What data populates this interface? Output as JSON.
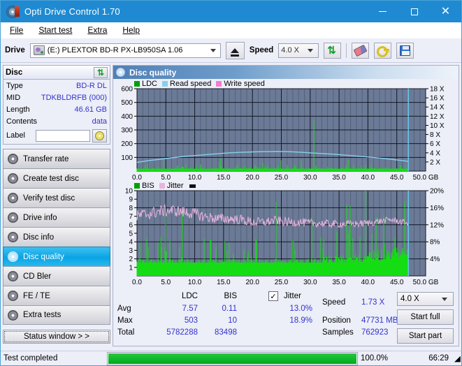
{
  "window": {
    "title": "Opti Drive Control 1.70",
    "icon": "disc-icon",
    "minimize": "minimize-icon",
    "maximize": "maximize-icon",
    "close": "close-icon"
  },
  "menu": [
    {
      "label": "File"
    },
    {
      "label": "Start test"
    },
    {
      "label": "Extra"
    },
    {
      "label": "Help"
    }
  ],
  "toolbar": {
    "drive_label": "Drive",
    "drive_value": "(E:)   PLEXTOR BD-R  PX-LB950SA 1.06",
    "eject_icon": "eject-icon",
    "speed_label": "Speed",
    "speed_value": "4.0 X",
    "refresh_icon": "refresh-icon",
    "eraser_icon": "eraser-icon",
    "key_icon": "key-icon",
    "save_icon": "save-icon"
  },
  "disc_panel": {
    "title": "Disc",
    "refresh_icon": "refresh-icon",
    "rows": [
      {
        "key": "Type",
        "value": "BD-R DL"
      },
      {
        "key": "MID",
        "value": "TDKBLDRFB (000)"
      },
      {
        "key": "Length",
        "value": "46.61 GB"
      },
      {
        "key": "Contents",
        "value": "data"
      }
    ],
    "label_key": "Label",
    "label_value": "",
    "label_button_icon": "disc-icon"
  },
  "nav": {
    "items": [
      {
        "label": "Transfer rate",
        "active": false
      },
      {
        "label": "Create test disc",
        "active": false
      },
      {
        "label": "Verify test disc",
        "active": false
      },
      {
        "label": "Drive info",
        "active": false
      },
      {
        "label": "Disc info",
        "active": false
      },
      {
        "label": "Disc quality",
        "active": true
      },
      {
        "label": "CD Bler",
        "active": false
      },
      {
        "label": "FE / TE",
        "active": false
      },
      {
        "label": "Extra tests",
        "active": false
      }
    ],
    "status_window": "Status window > >"
  },
  "main": {
    "title": "Disc quality",
    "icon": "disc-quality-icon"
  },
  "chart_data": [
    {
      "type": "line",
      "name": "ldc-chart",
      "title": "",
      "xlabel": "GB",
      "ylabel": "",
      "xlim": [
        0,
        50
      ],
      "ylim": [
        0,
        600
      ],
      "ylim_right": [
        0,
        18
      ],
      "grid": true,
      "legend_position": "top-left",
      "legend": [
        {
          "label": "LDC",
          "color": "#00a000"
        },
        {
          "label": "Read speed",
          "color": "#85d0ee"
        },
        {
          "label": "Write speed",
          "color": "#f57ad2"
        }
      ],
      "xticks": [
        "0.0",
        "5.0",
        "10.0",
        "15.0",
        "20.0",
        "25.0",
        "30.0",
        "35.0",
        "40.0",
        "45.0",
        "50.0 GB"
      ],
      "yticks_left": [
        "100",
        "200",
        "300",
        "400",
        "500",
        "600"
      ],
      "yticks_right": [
        "2 X",
        "4 X",
        "6 X",
        "8 X",
        "10 X",
        "12 X",
        "14 X",
        "16 X",
        "18 X"
      ],
      "series": [
        {
          "name": "Read speed",
          "color": "#85d0ee",
          "x": [
            0,
            2,
            4,
            6,
            8,
            10,
            12,
            14,
            16,
            18,
            20,
            22,
            24,
            26,
            28,
            30,
            32,
            34,
            36,
            38,
            40,
            42,
            44,
            46,
            47
          ],
          "y": [
            1.9,
            2.3,
            2.6,
            2.9,
            3.2,
            3.4,
            3.6,
            3.8,
            4.0,
            4.1,
            4.2,
            4.25,
            4.3,
            4.25,
            4.15,
            4.0,
            3.85,
            3.7,
            3.5,
            3.3,
            3.1,
            2.85,
            2.6,
            2.3,
            2.1
          ]
        },
        {
          "name": "LDC",
          "color": "#00d000",
          "note": "dense vertical error spikes, baseline ~20, peaks up to 503 at 18.2 GB"
        }
      ],
      "data_end_gb": 47.0
    },
    {
      "type": "line",
      "name": "bis-jitter-chart",
      "title": "",
      "xlabel": "GB",
      "xlim": [
        0,
        50
      ],
      "ylim": [
        0,
        10
      ],
      "ylim_right": [
        0,
        20
      ],
      "grid": true,
      "legend_position": "top-left",
      "legend": [
        {
          "label": "BIS",
          "color": "#00a000"
        },
        {
          "label": "Jitter",
          "color": "#e8b4dd"
        }
      ],
      "xticks": [
        "0.0",
        "5.0",
        "10.0",
        "15.0",
        "20.0",
        "25.0",
        "30.0",
        "35.0",
        "40.0",
        "45.0",
        "50.0 GB"
      ],
      "yticks_left": [
        "1",
        "2",
        "3",
        "4",
        "5",
        "6",
        "7",
        "8",
        "9",
        "10"
      ],
      "yticks_right": [
        "4%",
        "8%",
        "12%",
        "16%",
        "20%"
      ],
      "series": [
        {
          "name": "Jitter",
          "color": "#e8b4dd",
          "x": [
            0,
            2,
            4,
            6,
            8,
            10,
            12,
            14,
            16,
            18,
            20,
            22,
            24,
            26,
            28,
            30,
            32,
            34,
            36,
            38,
            40,
            42,
            44,
            46,
            47
          ],
          "y": [
            14.0,
            14.6,
            15.2,
            15.4,
            15.0,
            14.6,
            13.8,
            13.4,
            13.4,
            13.2,
            12.6,
            12.6,
            13.0,
            12.6,
            12.6,
            12.4,
            12.3,
            12.2,
            12.2,
            12.2,
            12.4,
            12.8,
            13.2,
            12.6,
            12.4
          ]
        },
        {
          "name": "BIS",
          "color": "#00d000",
          "note": "baseline ~2, frequent spikes to 3-10"
        }
      ],
      "data_end_gb": 47.0
    }
  ],
  "stats": {
    "col_headers": [
      "LDC",
      "BIS"
    ],
    "row_headers": [
      "Avg",
      "Max",
      "Total"
    ],
    "ldc": {
      "avg": "7.57",
      "max": "503",
      "total": "5782288"
    },
    "bis": {
      "avg": "0.11",
      "max": "10",
      "total": "83498"
    },
    "jitter": {
      "label": "Jitter",
      "checked": true,
      "avg": "13.0%",
      "max": "18.9%"
    },
    "speed_label": "Speed",
    "speed_value": "1.73 X",
    "position_label": "Position",
    "position_value": "47731 MB",
    "samples_label": "Samples",
    "samples_value": "762923",
    "speed_select": "4.0 X",
    "start_full": "Start full",
    "start_part": "Start part"
  },
  "statusbar": {
    "message": "Test completed",
    "progress_percent": 100.0,
    "progress_text": "100.0%",
    "elapsed": "66:29"
  }
}
